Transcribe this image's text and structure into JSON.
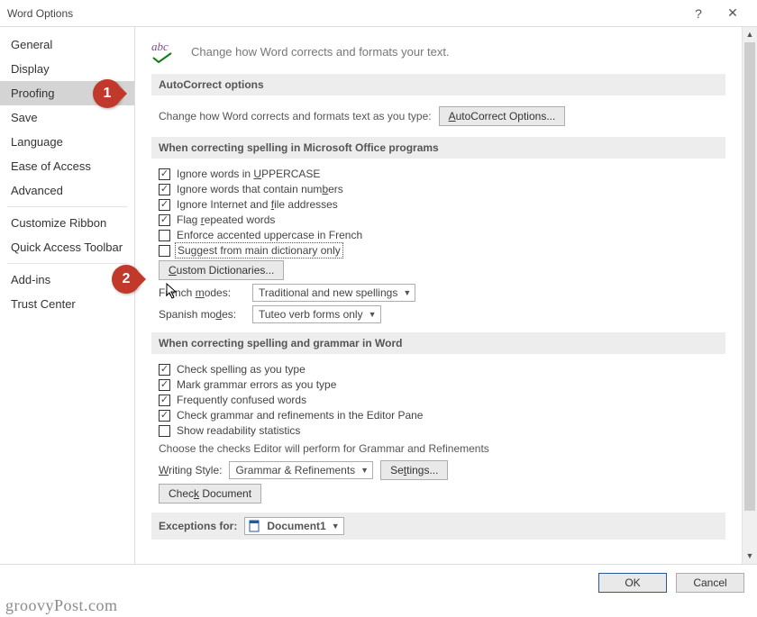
{
  "window": {
    "title": "Word Options"
  },
  "sidebar": {
    "items": [
      "General",
      "Display",
      "Proofing",
      "Save",
      "Language",
      "Ease of Access",
      "Advanced",
      "Customize Ribbon",
      "Quick Access Toolbar",
      "Add-ins",
      "Trust Center"
    ],
    "selected_index": 2
  },
  "header": {
    "abc_label": "abc",
    "text": "Change how Word corrects and formats your text."
  },
  "sections": {
    "autocorrect": {
      "title": "AutoCorrect options",
      "desc": "Change how Word corrects and formats text as you type:",
      "button": "AutoCorrect Options..."
    },
    "office_spell": {
      "title": "When correcting spelling in Microsoft Office programs",
      "checks": [
        {
          "label_html": "Ignore words in <u>U</u>PPERCASE",
          "checked": true
        },
        {
          "label_html": "Ignore words that contain num<u>b</u>ers",
          "checked": true
        },
        {
          "label_html": "Ignore Internet and <u>f</u>ile addresses",
          "checked": true
        },
        {
          "label_html": "Flag <u>r</u>epeated words",
          "checked": true
        },
        {
          "label_html": "Enforce accented uppercase in French",
          "checked": false
        },
        {
          "label_html": "Suggest from main dictionary only",
          "checked": false,
          "focused": true
        }
      ],
      "custom_dict_btn": "Custom Dictionaries...",
      "french_label": "French modes:",
      "french_value": "Traditional and new spellings",
      "spanish_label": "Spanish modes:",
      "spanish_value": "Tuteo verb forms only"
    },
    "word_spell": {
      "title": "When correcting spelling and grammar in Word",
      "checks": [
        {
          "label_html": "Check spelling as you type",
          "checked": true
        },
        {
          "label_html": "Mark grammar errors as you type",
          "checked": true
        },
        {
          "label_html": "Frequently confused words",
          "checked": true
        },
        {
          "label_html": "Check grammar and refinements in the Editor Pane",
          "checked": true
        },
        {
          "label_html": "Show readability statistics",
          "checked": false
        }
      ],
      "style_desc": "Choose the checks Editor will perform for Grammar and Refinements",
      "writing_style_label": "Writing Style:",
      "writing_style_value": "Grammar & Refinements",
      "settings_btn": "Settings...",
      "check_doc_btn": "Check Document"
    },
    "exceptions": {
      "title": "Exceptions for:",
      "value": "Document1"
    }
  },
  "footer": {
    "ok": "OK",
    "cancel": "Cancel"
  },
  "annotations": {
    "a1": "1",
    "a2": "2"
  },
  "watermark": "groovyPost.com"
}
